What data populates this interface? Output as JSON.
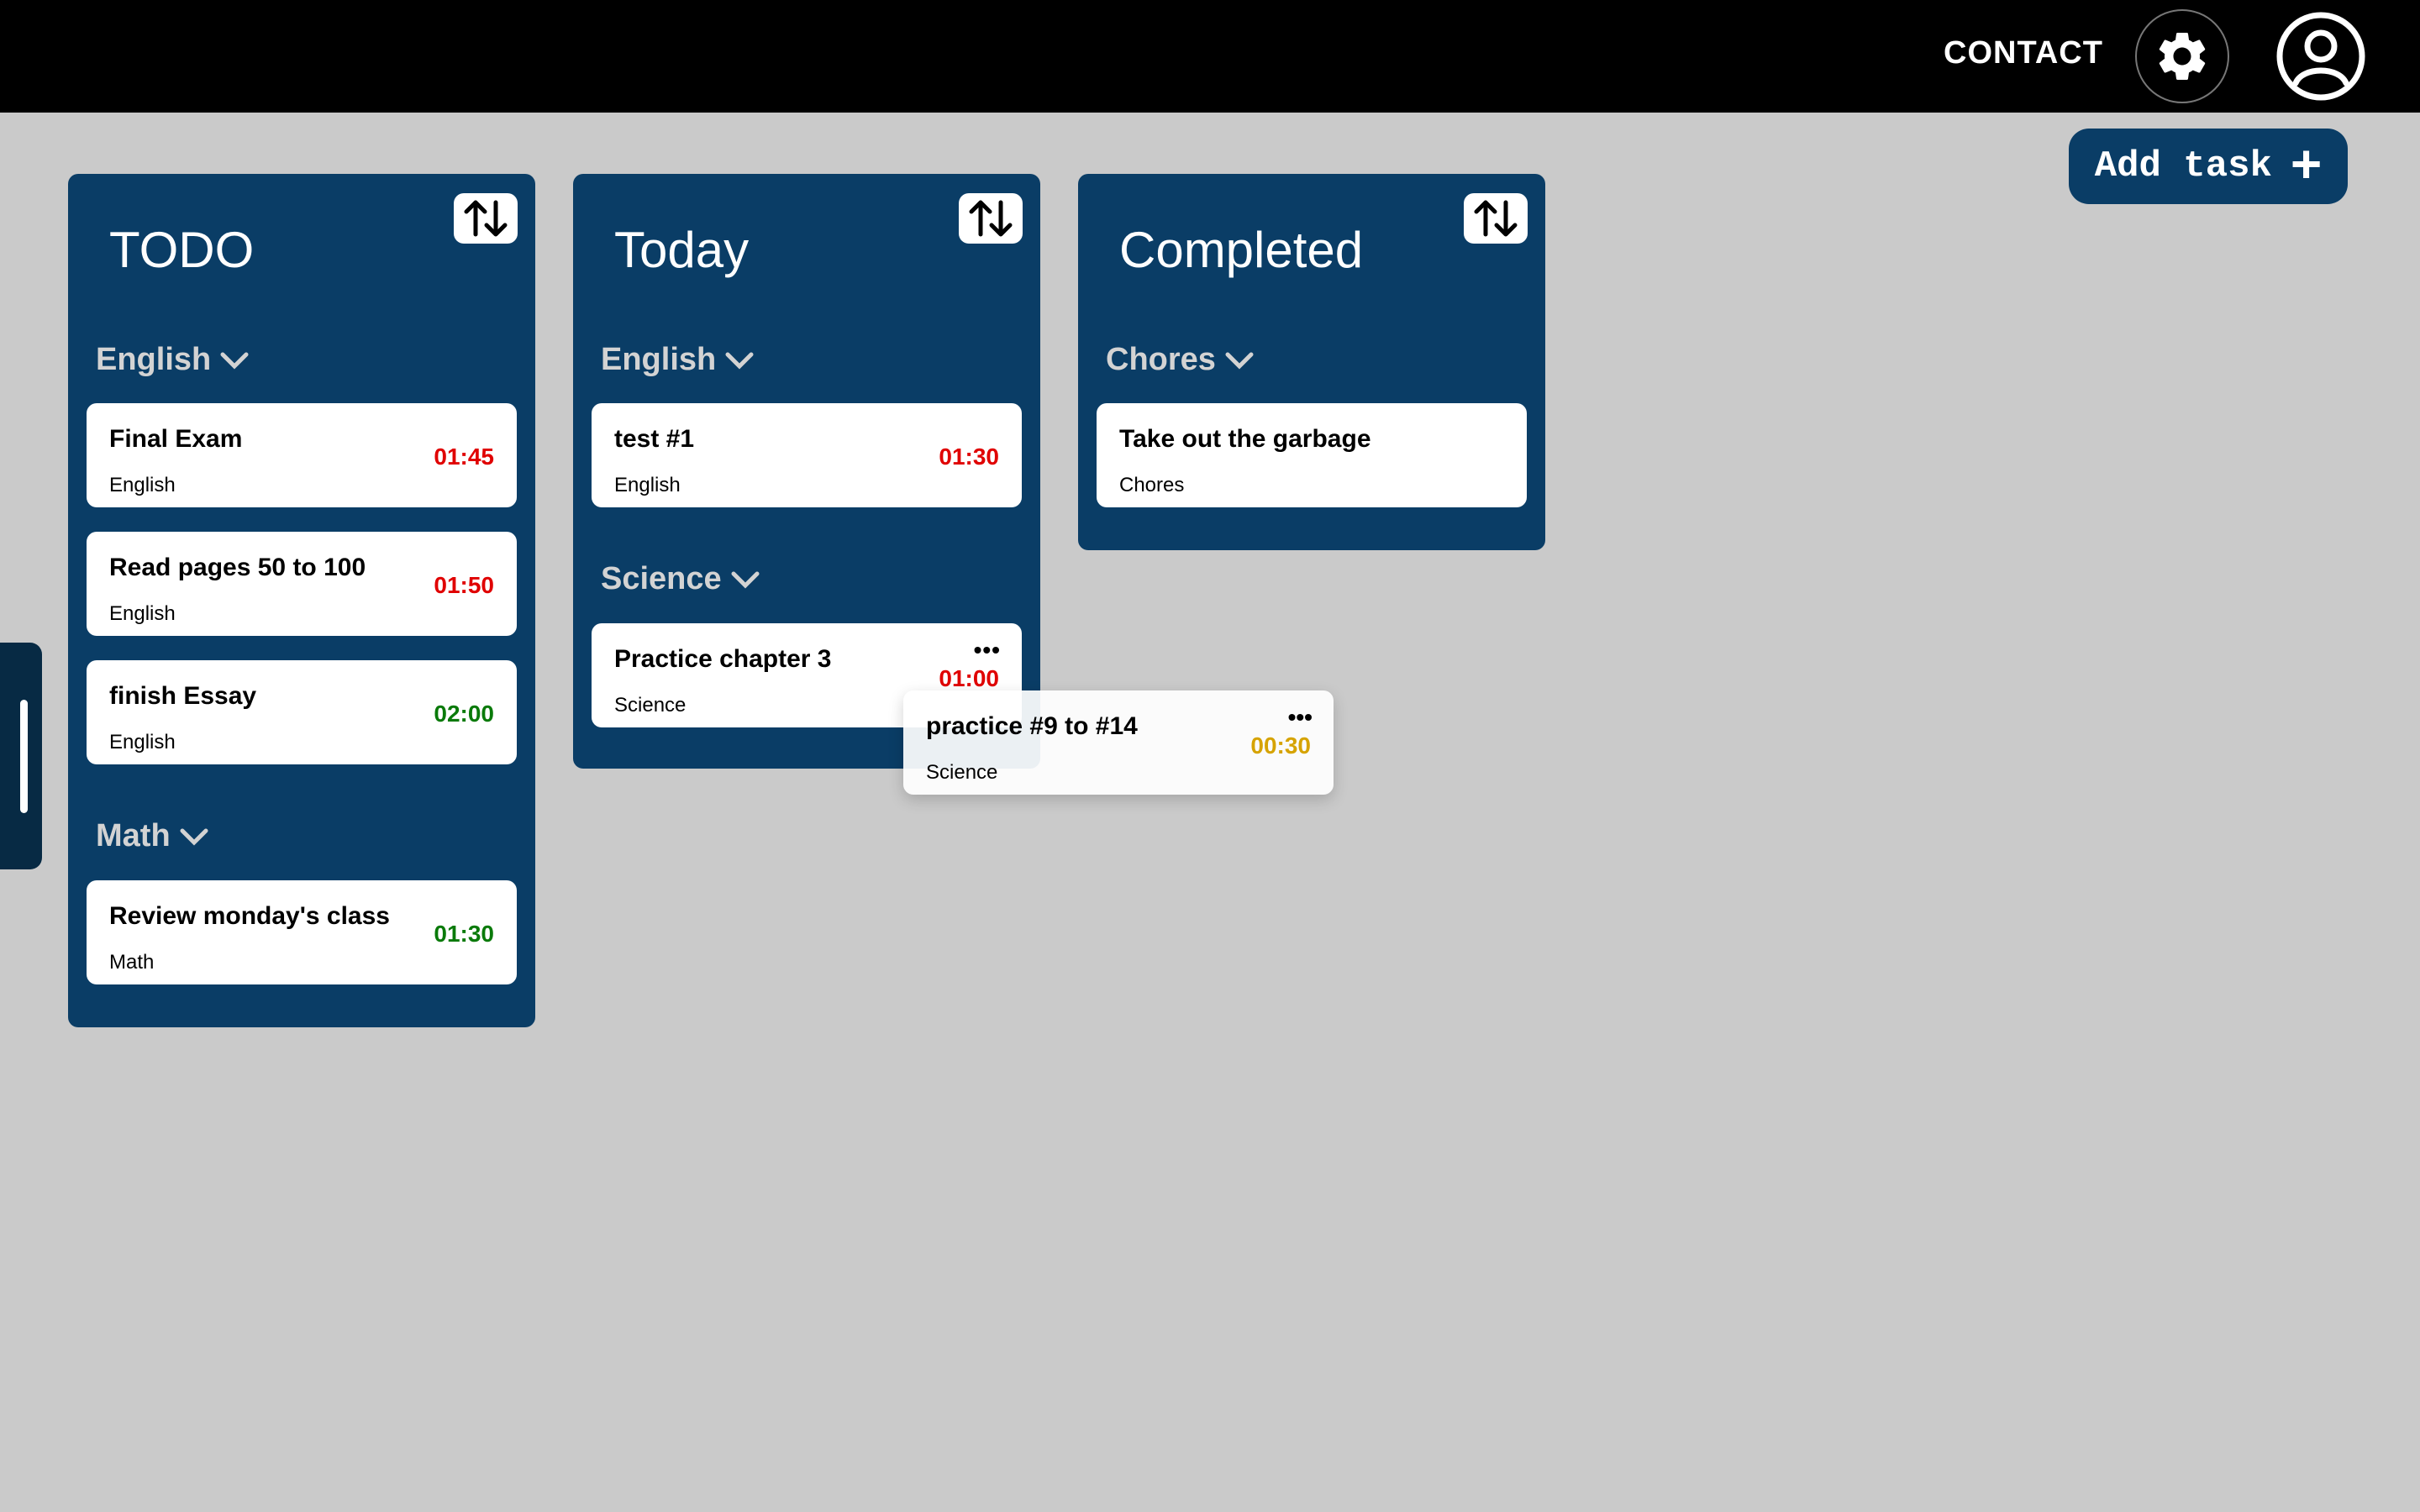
{
  "header": {
    "contact_label": "CONTACT",
    "settings_icon": "gear-icon",
    "profile_icon": "user-circle-icon"
  },
  "toolbar": {
    "add_task_label": "Add task",
    "add_icon": "+"
  },
  "colors": {
    "panel": "#0a3d66",
    "overdue": "#e00000",
    "ok": "#0a7a0a",
    "warn": "#d6a300"
  },
  "columns": [
    {
      "title": "TODO",
      "groups": [
        {
          "name": "English",
          "tasks": [
            {
              "title": "Final Exam",
              "category": "English",
              "time": "01:45",
              "status": "overdue"
            },
            {
              "title": "Read pages 50 to 100",
              "category": "English",
              "time": "01:50",
              "status": "overdue"
            },
            {
              "title": "finish Essay",
              "category": "English",
              "time": "02:00",
              "status": "ok"
            }
          ]
        },
        {
          "name": "Math",
          "tasks": [
            {
              "title": "Review monday's class",
              "category": "Math",
              "time": "01:30",
              "status": "ok"
            }
          ]
        }
      ]
    },
    {
      "title": "Today",
      "groups": [
        {
          "name": "English",
          "tasks": [
            {
              "title": "test #1",
              "category": "English",
              "time": "01:30",
              "status": "overdue"
            }
          ]
        },
        {
          "name": "Science",
          "tasks": [
            {
              "title": "Practice chapter 3",
              "category": "Science",
              "time": "01:00",
              "status": "overdue",
              "menu": "•••"
            }
          ]
        }
      ]
    },
    {
      "title": "Completed",
      "groups": [
        {
          "name": "Chores",
          "tasks": [
            {
              "title": "Take out the garbage",
              "category": "Chores"
            }
          ]
        }
      ]
    }
  ],
  "dragging_task": {
    "title": "practice #9 to #14",
    "category": "Science",
    "time": "00:30",
    "status": "warn",
    "menu": "•••"
  }
}
